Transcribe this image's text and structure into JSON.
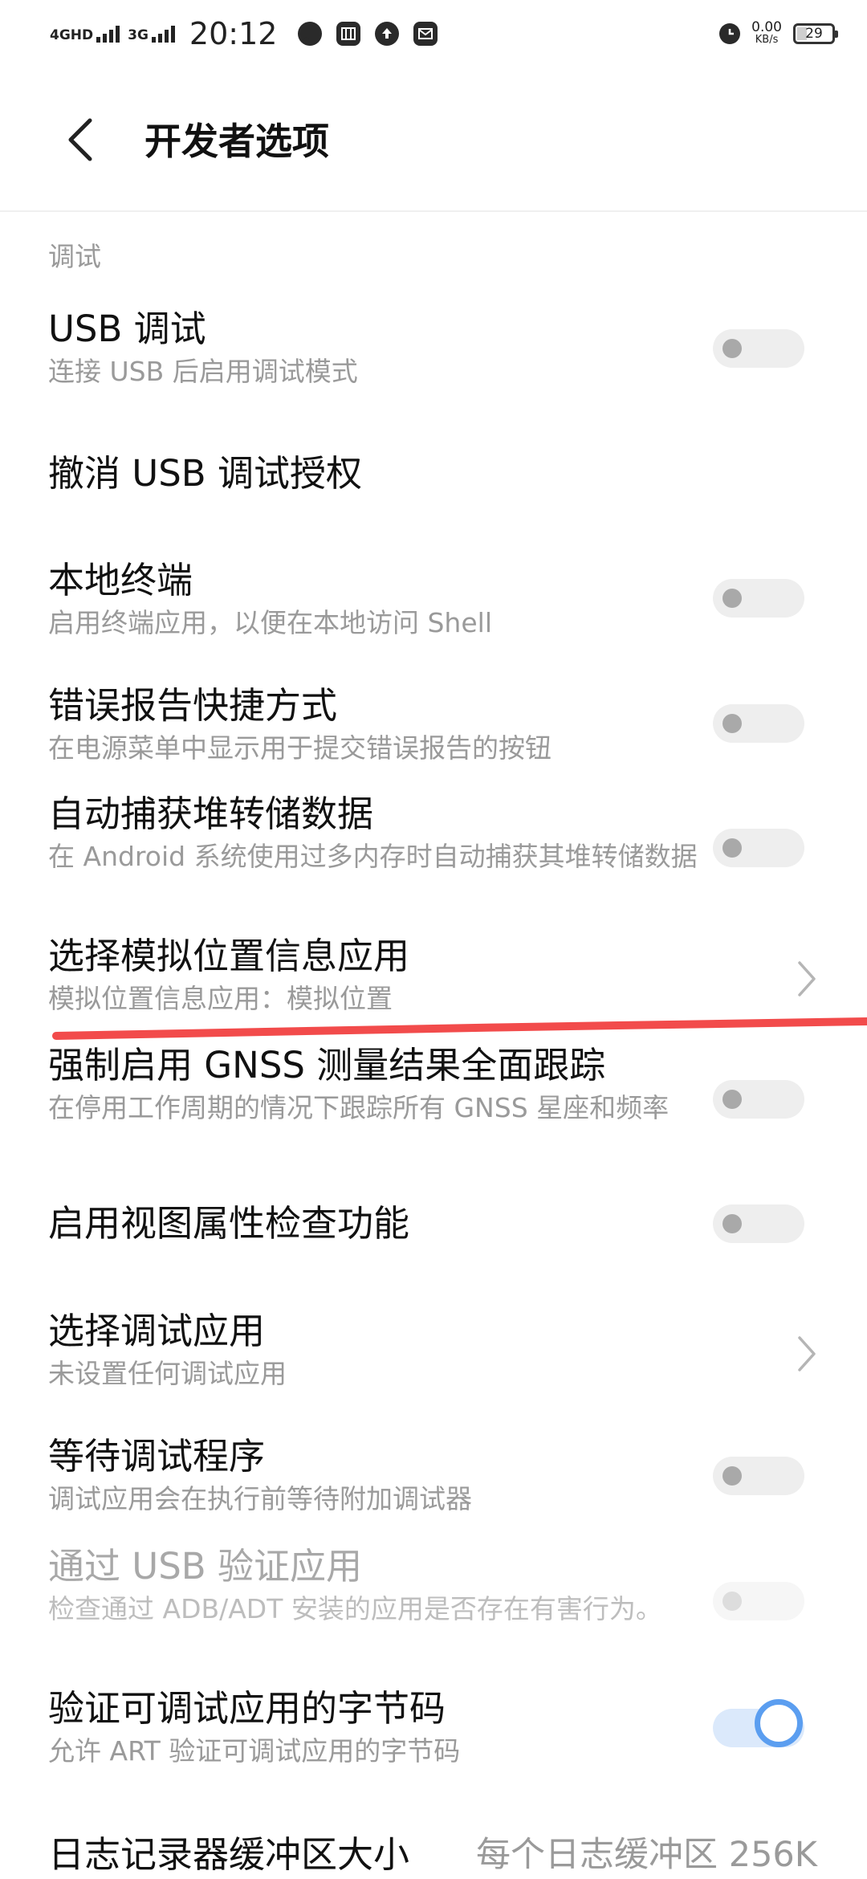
{
  "status_bar": {
    "signal1_label": "4GHD",
    "signal2_label": "3G",
    "time": "20:12",
    "icons": [
      "chat-bubble-icon",
      "app-store-icon",
      "upload-icon",
      "mail-icon"
    ],
    "alarm_icon": "alarm-clock-icon",
    "net_speed_value": "0.00",
    "net_speed_unit": "KB/s",
    "battery_level": "29"
  },
  "header": {
    "back_icon": "chevron-left-icon",
    "title": "开发者选项"
  },
  "section": {
    "title": "调试"
  },
  "settings": [
    {
      "title": "USB 调试",
      "subtitle": "连接 USB 后启用调试模式",
      "control": "toggle",
      "on": false,
      "enabled": true
    },
    {
      "title": "撤消 USB 调试授权",
      "subtitle": "",
      "control": "none",
      "on": false,
      "enabled": true
    },
    {
      "title": "本地终端",
      "subtitle": "启用终端应用，以便在本地访问 Shell",
      "control": "toggle",
      "on": false,
      "enabled": true
    },
    {
      "title": "错误报告快捷方式",
      "subtitle": "在电源菜单中显示用于提交错误报告的按钮",
      "control": "toggle",
      "on": false,
      "enabled": true
    },
    {
      "title": "自动捕获堆转储数据",
      "subtitle": "在 Android 系统使用过多内存时自动捕获其堆转储数据",
      "control": "toggle",
      "on": false,
      "enabled": true
    },
    {
      "title": "选择模拟位置信息应用",
      "subtitle": "模拟位置信息应用：模拟位置",
      "control": "chevron",
      "on": false,
      "enabled": true
    },
    {
      "title": "强制启用 GNSS 测量结果全面跟踪",
      "subtitle": "在停用工作周期的情况下跟踪所有 GNSS 星座和频率",
      "control": "toggle",
      "on": false,
      "enabled": true
    },
    {
      "title": "启用视图属性检查功能",
      "subtitle": "",
      "control": "toggle",
      "on": false,
      "enabled": true
    },
    {
      "title": "选择调试应用",
      "subtitle": "未设置任何调试应用",
      "control": "chevron",
      "on": false,
      "enabled": true
    },
    {
      "title": "等待调试程序",
      "subtitle": "调试应用会在执行前等待附加调试器",
      "control": "toggle",
      "on": false,
      "enabled": true
    },
    {
      "title": "通过 USB 验证应用",
      "subtitle": "检查通过 ADB/ADT 安装的应用是否存在有害行为。",
      "control": "toggle",
      "on": false,
      "enabled": false
    },
    {
      "title": "验证可调试应用的字节码",
      "subtitle": "允许 ART 验证可调试应用的字节码",
      "control": "toggle",
      "on": true,
      "enabled": true
    },
    {
      "title": "日志记录器缓冲区大小",
      "subtitle": "",
      "control": "value",
      "value": "每个日志缓冲区 256K",
      "on": false,
      "enabled": true
    }
  ],
  "colors": {
    "accent": "#5b9ef0",
    "annotation_mark": "#f24b4b",
    "subtitle_text": "#9a9a9a"
  }
}
